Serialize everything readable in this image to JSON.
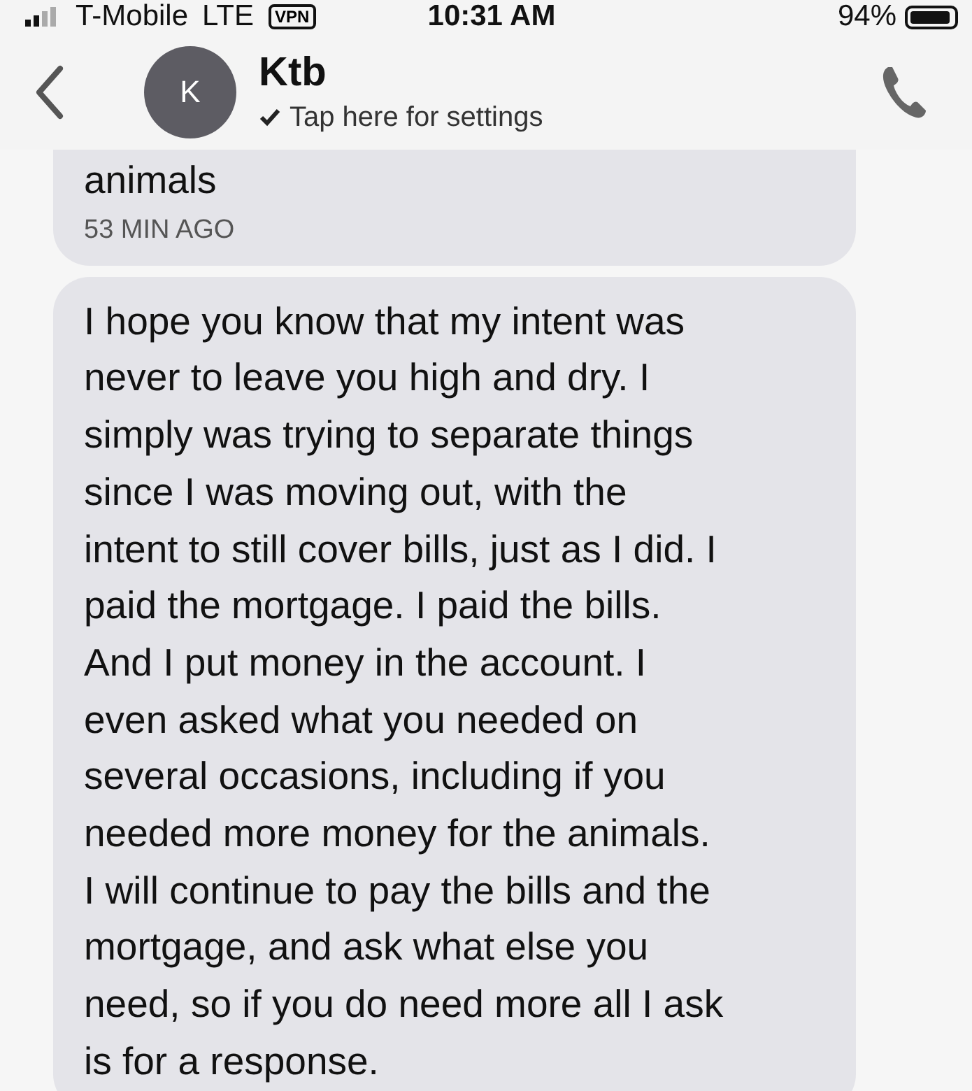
{
  "status_bar": {
    "carrier": "T-Mobile",
    "network": "LTE",
    "vpn": "VPN",
    "time": "10:31 AM",
    "battery": "94%"
  },
  "header": {
    "avatar": "K",
    "name": "Ktb",
    "subtitle": "Tap here for settings"
  },
  "messages": [
    {
      "text": "animals",
      "time": "53 MIN AGO"
    },
    {
      "text": "I hope you know that my intent was\nnever to leave you high and dry. I\nsimply was trying to separate things\nsince I was moving out, with the\nintent to still cover bills, just as I did. I\npaid the mortgage. I paid the bills.\nAnd I put money in the account. I\neven asked what you needed on\nseveral occasions, including if you\nneeded more money for the animals.\nI will continue to pay the bills and the\nmortgage, and ask what else you\nneed, so if you do need more all I ask\nis for a response."
    }
  ]
}
